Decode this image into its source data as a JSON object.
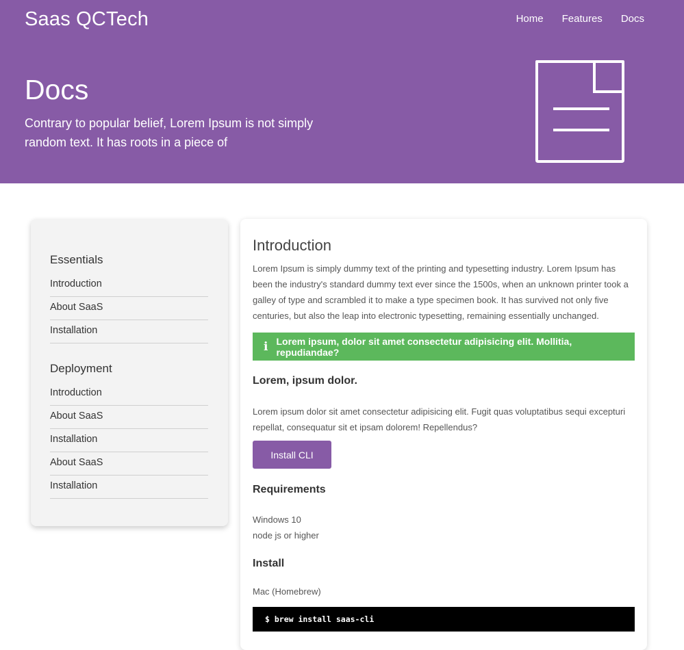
{
  "header": {
    "brand": "Saas QCTech",
    "nav": [
      "Home",
      "Features",
      "Docs"
    ],
    "title": "Docs",
    "subtitle": "Contrary to popular belief, Lorem Ipsum is not simply random text. It has roots in a piece of",
    "icon": "document-icon",
    "color": "#875ba6"
  },
  "sidebar": {
    "groups": [
      {
        "heading": "Essentials",
        "items": [
          "Introduction",
          "About SaaS",
          "Installation"
        ]
      },
      {
        "heading": "Deployment",
        "items": [
          "Introduction",
          "About SaaS",
          "Installation",
          "About SaaS",
          "Installation"
        ]
      }
    ]
  },
  "content": {
    "intro_title": "Introduction",
    "intro_text": "Lorem Ipsum is simply dummy text of the printing and typesetting industry. Lorem Ipsum has been the industry's standard dummy text ever since the 1500s, when an unknown printer took a galley of type and scrambled it to make a type specimen book. It has survived not only five centuries, but also the leap into electronic typesetting, remaining essentially unchanged.",
    "alert": {
      "icon": "info-icon",
      "text": "Lorem ipsum, dolor sit amet consectetur adipisicing elit. Mollitia, repudiandae?",
      "color": "#5cb85c"
    },
    "sub_title": "Lorem, ipsum dolor.",
    "sub_text": "Lorem ipsum dolor sit amet consectetur adipisicing elit. Fugit quas voluptatibus sequi excepturi repellat, consequatur sit et ipsam dolorem! Repellendus?",
    "button": "Install CLI",
    "requirements_title": "Requirements",
    "requirements": [
      "Windows 10",
      "node js or higher"
    ],
    "install_title": "Install",
    "mac_label": "Mac (Homebrew)",
    "code": "$ brew install saas-cli"
  }
}
